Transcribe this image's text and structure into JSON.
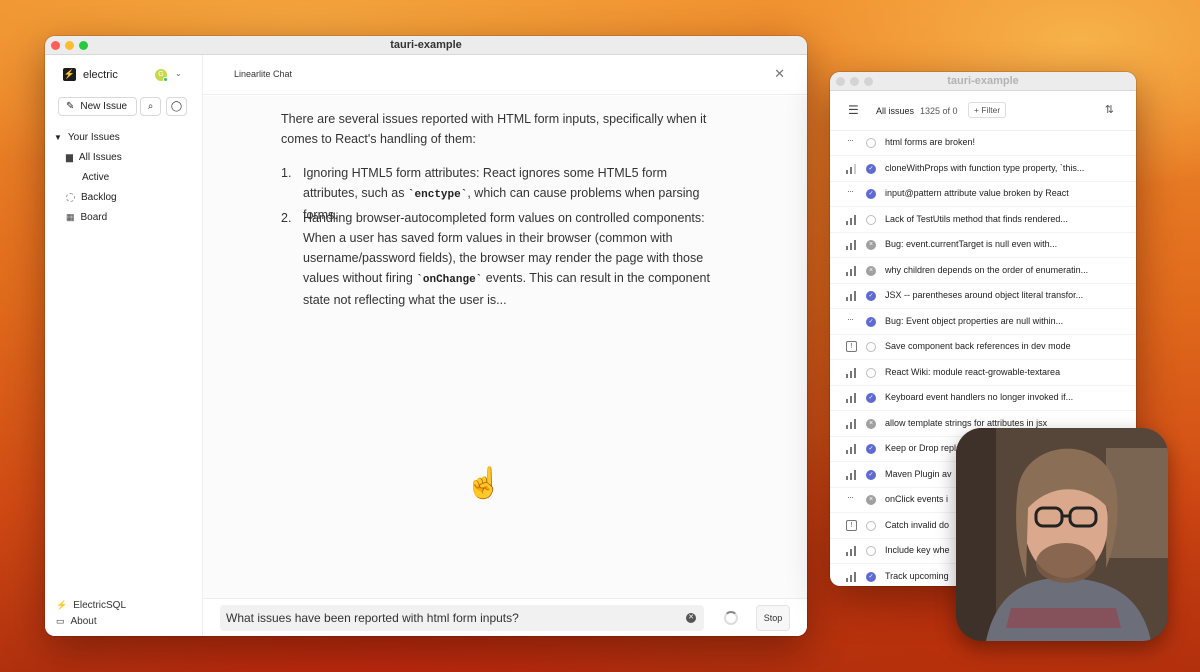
{
  "main_window": {
    "title": "tauri-example",
    "sidebar": {
      "brand": "electric",
      "avatar_initial": "G",
      "new_issue": "New Issue",
      "section": "Your Issues",
      "items": [
        "All Issues",
        "Active",
        "Backlog",
        "Board"
      ],
      "footer": [
        "ElectricSQL",
        "About"
      ]
    },
    "chat": {
      "title": "Linearlite Chat",
      "intro": "There are several issues reported with HTML form inputs, specifically when it comes to React's handling of them:",
      "item1": {
        "num": "1.",
        "text_a": "Ignoring HTML5 form attributes: React ignores some HTML5 form attributes, such as ",
        "code": "`enctype`",
        "text_b": ", which can cause problems when parsing forms."
      },
      "item2": {
        "num": "2.",
        "text_a": "Handling browser-autocompleted form values on controlled components: When a user has saved form values in their browser (common with username/password fields), the browser may render the page with those values without firing ",
        "code": "`onChange`",
        "text_b": " events. This can result in the component state not reflecting what the user is..."
      },
      "input_value": "What issues have been reported with html form inputs?",
      "stop_label": "Stop"
    }
  },
  "issues_window": {
    "title": "tauri-example",
    "all_issues": "All issues",
    "count": "1325 of 0",
    "filter": "+ Filter",
    "rows": [
      {
        "priority": "none",
        "status": "todo",
        "title": "html forms are broken!"
      },
      {
        "priority": "medium",
        "status": "done",
        "title": "cloneWithProps with function type property, `this..."
      },
      {
        "priority": "none",
        "status": "done",
        "title": "input@pattern attribute value broken by React"
      },
      {
        "priority": "high",
        "status": "todo",
        "title": "Lack of TestUtils method that finds rendered..."
      },
      {
        "priority": "high",
        "status": "canceled",
        "title": "Bug: event.currentTarget is null even with..."
      },
      {
        "priority": "high",
        "status": "canceled",
        "title": "why children depends on the order of enumeratin..."
      },
      {
        "priority": "high",
        "status": "done",
        "title": "JSX -- parentheses around object literal transfor..."
      },
      {
        "priority": "none",
        "status": "done",
        "title": "Bug: Event object properties are null within..."
      },
      {
        "priority": "urgent",
        "status": "todo",
        "title": "Save component back references in dev mode"
      },
      {
        "priority": "high",
        "status": "todo",
        "title": "React Wiki: module react-growable-textarea"
      },
      {
        "priority": "high",
        "status": "done",
        "title": "Keyboard event handlers no longer invoked if..."
      },
      {
        "priority": "high",
        "status": "canceled",
        "title": "allow template strings for attributes in jsx"
      },
      {
        "priority": "high",
        "status": "done",
        "title": "Keep or Drop repla"
      },
      {
        "priority": "high",
        "status": "done",
        "title": "Maven Plugin av"
      },
      {
        "priority": "none",
        "status": "canceled",
        "title": "onClick events i"
      },
      {
        "priority": "urgent",
        "status": "todo",
        "title": "Catch invalid do"
      },
      {
        "priority": "high",
        "status": "todo",
        "title": "Include key whe"
      },
      {
        "priority": "high",
        "status": "done",
        "title": "Track upcoming"
      }
    ]
  },
  "colors": {
    "accent": "#5e6ad2",
    "brand_green": "#3fe07d"
  }
}
